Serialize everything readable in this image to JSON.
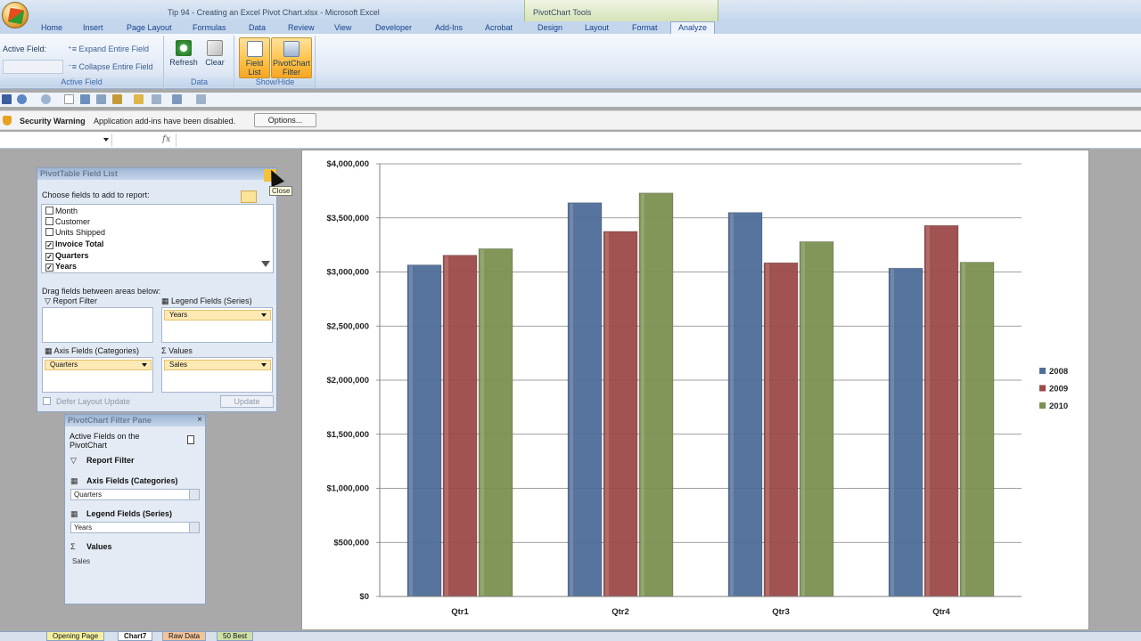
{
  "window": {
    "title": "Tip 94 - Creating an Excel Pivot Chart.xlsx - Microsoft Excel",
    "context_title": "PivotChart Tools"
  },
  "tabs": [
    "Home",
    "Insert",
    "Page Layout",
    "Formulas",
    "Data",
    "Review",
    "View",
    "Developer",
    "Add-Ins",
    "Acrobat",
    "Design",
    "Layout",
    "Format",
    "Analyze"
  ],
  "active_tab": "Analyze",
  "ribbon": {
    "active_field_label": "Active Field:",
    "expand_label": "Expand Entire Field",
    "collapse_label": "Collapse Entire Field",
    "group_active_field": "Active Field",
    "refresh_label": "Refresh",
    "clear_label": "Clear",
    "group_data": "Data",
    "field_list_label": "Field List",
    "pivotchart_filter_label": "PivotChart Filter",
    "group_showhide": "Show/Hide"
  },
  "security": {
    "title": "Security Warning",
    "message": "Application add-ins have been disabled.",
    "options_label": "Options..."
  },
  "fieldlist": {
    "title": "PivotTable Field List",
    "choose_label": "Choose fields to add to report:",
    "fields": [
      {
        "name": "Month",
        "checked": false
      },
      {
        "name": "Customer",
        "checked": false
      },
      {
        "name": "Units Shipped",
        "checked": false
      },
      {
        "name": "Invoice Total",
        "checked": true
      },
      {
        "name": "Quarters",
        "checked": true
      },
      {
        "name": "Years",
        "checked": true
      }
    ],
    "drag_label": "Drag fields between areas below:",
    "report_filter_label": "Report Filter",
    "legend_fields_label": "Legend Fields (Series)",
    "axis_fields_label": "Axis Fields (Categories)",
    "values_label": "Values",
    "legend_item": "Years",
    "axis_item": "Quarters",
    "values_item": "Sales",
    "defer_label": "Defer Layout Update",
    "update_label": "Update",
    "close_tooltip": "Close"
  },
  "filterpane": {
    "title": "PivotChart Filter Pane",
    "active_fields": "Active Fields on the PivotChart",
    "report_filter": "Report Filter",
    "axis_fields": "Axis Fields (Categories)",
    "axis_value": "Quarters",
    "legend_fields": "Legend Fields (Series)",
    "legend_value": "Years",
    "values": "Values",
    "values_item": "Sales"
  },
  "sheets": [
    "Opening Page",
    "Chart7",
    "Raw Data",
    "50 Best"
  ],
  "active_sheet": "Chart7",
  "chart_data": {
    "type": "bar",
    "categories": [
      "Qtr1",
      "Qtr2",
      "Qtr3",
      "Qtr4"
    ],
    "series": [
      {
        "name": "2008",
        "color": "#4f6d99",
        "values": [
          3065000,
          3640000,
          3550000,
          3035000
        ]
      },
      {
        "name": "2009",
        "color": "#9c4a48",
        "values": [
          3155000,
          3375000,
          3085000,
          3430000
        ]
      },
      {
        "name": "2010",
        "color": "#7c9152",
        "values": [
          3215000,
          3730000,
          3280000,
          3090000
        ]
      }
    ],
    "ylim": [
      0,
      4000000
    ],
    "yticks": [
      0,
      500000,
      1000000,
      1500000,
      2000000,
      2500000,
      3000000,
      3500000,
      4000000
    ],
    "ytick_labels": [
      "$0",
      "$500,000",
      "$1,000,000",
      "$1,500,000",
      "$2,000,000",
      "$2,500,000",
      "$3,000,000",
      "$3,500,000",
      "$4,000,000"
    ],
    "grid": true,
    "legend_position": "right"
  }
}
